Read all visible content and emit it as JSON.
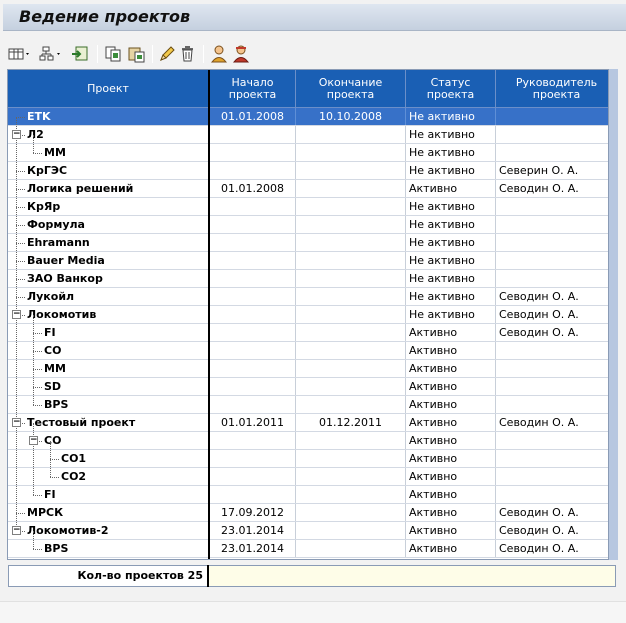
{
  "window": {
    "title": "Ведение проектов"
  },
  "toolbar": {
    "buttons": [
      {
        "name": "layout-menu-button",
        "icon": "table-layout-icon",
        "dropdown": true
      },
      {
        "name": "hierarchy-menu-button",
        "icon": "hierarchy-icon",
        "dropdown": true
      },
      {
        "name": "export-button",
        "icon": "export-icon"
      },
      {
        "name": "copy-button",
        "icon": "copy-icon"
      },
      {
        "name": "paste-button",
        "icon": "paste-icon"
      },
      {
        "name": "edit-button",
        "icon": "pencil-icon"
      },
      {
        "name": "delete-button",
        "icon": "trash-icon"
      },
      {
        "name": "user-button",
        "icon": "user-icon"
      },
      {
        "name": "manager-button",
        "icon": "manager-icon"
      }
    ]
  },
  "table": {
    "columns": [
      {
        "label": [
          "Проект"
        ]
      },
      {
        "label": [
          "Начало",
          "проекта"
        ]
      },
      {
        "label": [
          "Окончание",
          "проекта"
        ]
      },
      {
        "label": [
          "Статус",
          "проекта"
        ]
      },
      {
        "label": [
          "Руководитель",
          "проекта"
        ]
      }
    ],
    "rows": [
      {
        "name": "ETK",
        "start": "01.01.2008",
        "end": "10.10.2008",
        "status": "Не активно",
        "manager": "",
        "level": 0,
        "expander": "",
        "selected": true
      },
      {
        "name": "Л2",
        "start": "",
        "end": "",
        "status": "Не активно",
        "manager": "",
        "level": 0,
        "expander": "−"
      },
      {
        "name": "MM",
        "start": "",
        "end": "",
        "status": "Не активно",
        "manager": "",
        "level": 1,
        "expander": ""
      },
      {
        "name": "КрГЭС",
        "start": "",
        "end": "",
        "status": "Не активно",
        "manager": "Северин О. А.",
        "level": 0,
        "expander": ""
      },
      {
        "name": "Логика решений",
        "start": "01.01.2008",
        "end": "",
        "status": "Активно",
        "manager": "Севодин О. А.",
        "level": 0,
        "expander": ""
      },
      {
        "name": "КрЯр",
        "start": "",
        "end": "",
        "status": "Не активно",
        "manager": "",
        "level": 0,
        "expander": ""
      },
      {
        "name": "Формула",
        "start": "",
        "end": "",
        "status": "Не активно",
        "manager": "",
        "level": 0,
        "expander": ""
      },
      {
        "name": "Ehramann",
        "start": "",
        "end": "",
        "status": "Не активно",
        "manager": "",
        "level": 0,
        "expander": ""
      },
      {
        "name": "Bauer Media",
        "start": "",
        "end": "",
        "status": "Не активно",
        "manager": "",
        "level": 0,
        "expander": ""
      },
      {
        "name": "ЗАО Ванкор",
        "start": "",
        "end": "",
        "status": "Не активно",
        "manager": "",
        "level": 0,
        "expander": ""
      },
      {
        "name": "Лукойл",
        "start": "",
        "end": "",
        "status": "Не активно",
        "manager": "Севодин О. А.",
        "level": 0,
        "expander": ""
      },
      {
        "name": "Локомотив",
        "start": "",
        "end": "",
        "status": "Не активно",
        "manager": "Севодин О. А.",
        "level": 0,
        "expander": "−"
      },
      {
        "name": "FI",
        "start": "",
        "end": "",
        "status": "Активно",
        "manager": "Севодин О. А.",
        "level": 1,
        "expander": ""
      },
      {
        "name": "CO",
        "start": "",
        "end": "",
        "status": "Активно",
        "manager": "",
        "level": 1,
        "expander": ""
      },
      {
        "name": "MM",
        "start": "",
        "end": "",
        "status": "Активно",
        "manager": "",
        "level": 1,
        "expander": ""
      },
      {
        "name": "SD",
        "start": "",
        "end": "",
        "status": "Активно",
        "manager": "",
        "level": 1,
        "expander": ""
      },
      {
        "name": "BPS",
        "start": "",
        "end": "",
        "status": "Активно",
        "manager": "",
        "level": 1,
        "expander": ""
      },
      {
        "name": "Тестовый проект",
        "start": "01.01.2011",
        "end": "01.12.2011",
        "status": "Активно",
        "manager": "Севодин О. А.",
        "level": 0,
        "expander": "−"
      },
      {
        "name": "CO",
        "start": "",
        "end": "",
        "status": "Активно",
        "manager": "",
        "level": 1,
        "expander": "−"
      },
      {
        "name": "CO1",
        "start": "",
        "end": "",
        "status": "Активно",
        "manager": "",
        "level": 2,
        "expander": ""
      },
      {
        "name": "CO2",
        "start": "",
        "end": "",
        "status": "Активно",
        "manager": "",
        "level": 2,
        "expander": ""
      },
      {
        "name": "FI",
        "start": "",
        "end": "",
        "status": "Активно",
        "manager": "",
        "level": 1,
        "expander": ""
      },
      {
        "name": "МРСК",
        "start": "17.09.2012",
        "end": "",
        "status": "Активно",
        "manager": "Севодин О. А.",
        "level": 0,
        "expander": ""
      },
      {
        "name": "Локомотив-2",
        "start": "23.01.2014",
        "end": "",
        "status": "Активно",
        "manager": "Севодин О. А.",
        "level": 0,
        "expander": "−"
      },
      {
        "name": "BPS",
        "start": "23.01.2014",
        "end": "",
        "status": "Активно",
        "manager": "Севодин О. А.",
        "level": 1,
        "expander": ""
      }
    ]
  },
  "footer": {
    "count_label": "Кол-во проектов 25",
    "value": ""
  },
  "colors": {
    "header": "#1a5fb4",
    "selected_row": "#3771c8",
    "footer_value_bg": "#fefde8"
  }
}
